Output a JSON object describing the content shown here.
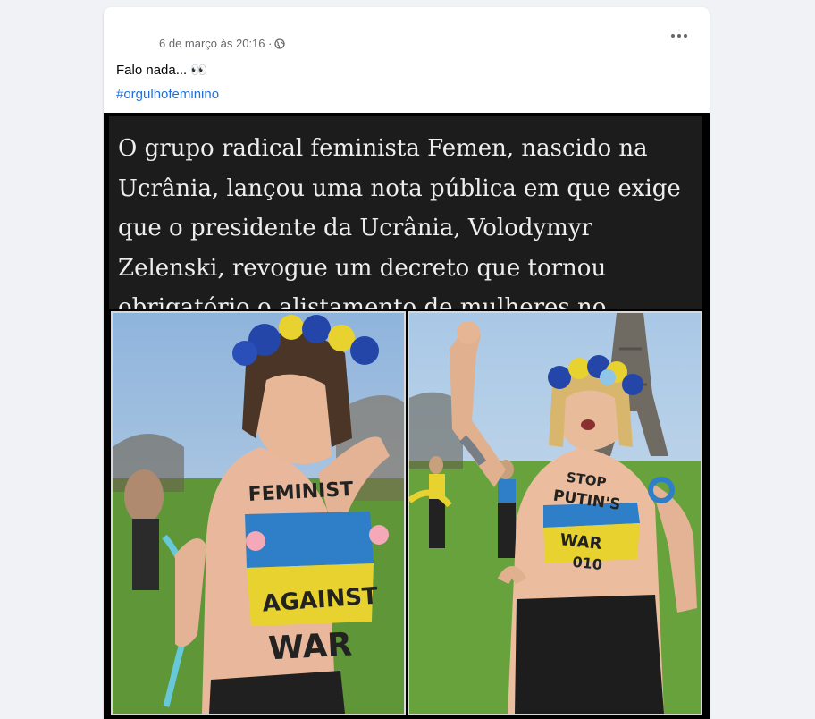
{
  "post": {
    "timestamp": "6 de março às 20:16 ·",
    "text": "Falo nada... 👀",
    "hashtag": "#orgulhofeminino",
    "more_icon": "more-horizontal-icon",
    "privacy_icon": "globe-icon"
  },
  "image": {
    "caption": "O grupo radical feminista Femen, nascido na Ucrânia, lançou uma nota pública em que exige que o presidente da Ucrânia, Volodymyr Zelenski, revogue um decreto que tornou obrigatório o alistamento de mulheres no serviço militar.",
    "left_photo": {
      "word1": "FEMINIST",
      "word2": "AGAINST",
      "word3": "WAR"
    },
    "right_photo": {
      "word1": "STOP",
      "word2": "PUTIN'S",
      "word3": "WAR",
      "word4": "010"
    }
  },
  "colors": {
    "link": "#216fdb",
    "flag_blue": "#2f7fc8",
    "flag_yellow": "#e8d230",
    "grass": "#5f9a3a",
    "sky": "#9ec0e0"
  }
}
